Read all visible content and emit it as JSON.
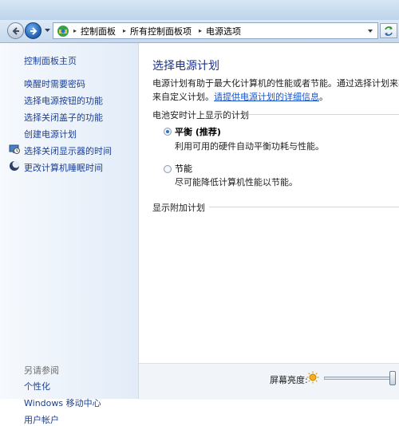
{
  "address_bar": {
    "breadcrumbs": [
      "控制面板",
      "所有控制面板项",
      "电源选项"
    ],
    "separator": "▸"
  },
  "sidebar": {
    "home": "控制面板主页",
    "links": [
      {
        "label": "唤醒时需要密码",
        "icon": null
      },
      {
        "label": "选择电源按钮的功能",
        "icon": null
      },
      {
        "label": "选择关闭盖子的功能",
        "icon": null
      },
      {
        "label": "创建电源计划",
        "icon": null
      },
      {
        "label": "选择关闭显示器的时间",
        "icon": "monitor-clock-icon"
      },
      {
        "label": "更改计算机睡眠时间",
        "icon": "moon-icon"
      }
    ],
    "see_also": {
      "heading": "另请参阅",
      "links": [
        "个性化",
        "Windows 移动中心",
        "用户帐户"
      ]
    }
  },
  "main": {
    "title": "选择电源计划",
    "description_line1": "电源计划有助于最大化计算机的性能或者节能。通过选择计划来将其激活，或选择一个计划并通过更改电源设置",
    "description_line2_prefix": "来自定义计划。",
    "description_link": "请提供电源计划的详细信息",
    "description_line2_suffix": "。",
    "section_battery": "电池安时计上显示的计划",
    "plans": [
      {
        "name": "平衡 (推荐)",
        "desc": "利用可用的硬件自动平衡功耗与性能。",
        "selected": true
      },
      {
        "name": "节能",
        "desc": "尽可能降低计算机性能以节能。",
        "selected": false
      }
    ],
    "section_additional": "显示附加计划"
  },
  "bottom": {
    "brightness_label": "屏幕亮度:",
    "brightness_level": 1.0
  },
  "colors": {
    "link": "#1c3f95",
    "title": "#1e3287",
    "accent": "#2a6ed6"
  }
}
